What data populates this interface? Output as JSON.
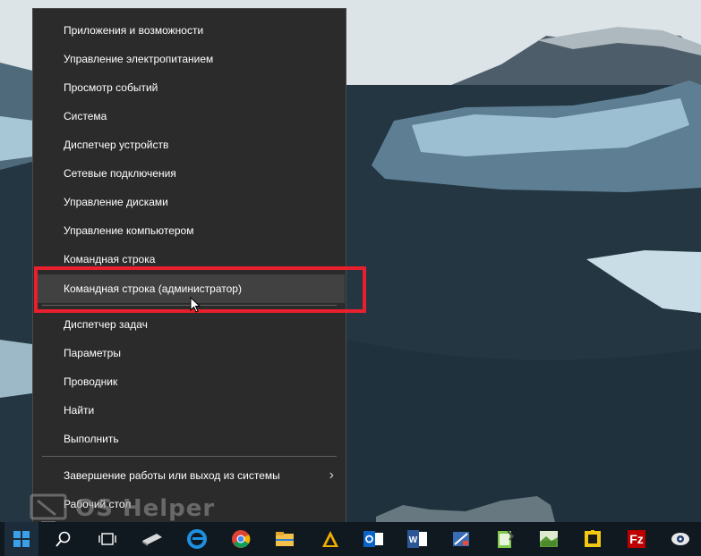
{
  "start_menu": {
    "items": [
      {
        "label": "Приложения и возможности"
      },
      {
        "label": "Управление электропитанием"
      },
      {
        "label": "Просмотр событий"
      },
      {
        "label": "Система"
      },
      {
        "label": "Диспетчер устройств"
      },
      {
        "label": "Сетевые подключения"
      },
      {
        "label": "Управление дисками"
      },
      {
        "label": "Управление компьютером"
      },
      {
        "label": "Командная строка"
      },
      {
        "label": "Командная строка (администратор)"
      },
      {
        "label": "Диспетчер задач"
      },
      {
        "label": "Параметры"
      },
      {
        "label": "Проводник"
      },
      {
        "label": "Найти"
      },
      {
        "label": "Выполнить"
      },
      {
        "label": "Завершение работы или выход из системы"
      },
      {
        "label": "Рабочий стол"
      }
    ],
    "highlight_color": "#e8202d"
  },
  "watermark": {
    "text": "OS Helper"
  },
  "taskbar": {
    "icons": [
      "windows-start-icon",
      "search-icon",
      "task-view-icon",
      "usb-drive-icon",
      "edge-icon",
      "chrome-icon",
      "file-explorer-icon",
      "winamp-icon",
      "outlook-icon",
      "word-icon",
      "image-editor-icon",
      "notepad-icon",
      "png-viewer-icon",
      "puzzle-app-icon",
      "filezilla-icon",
      "screen-app-icon"
    ]
  }
}
